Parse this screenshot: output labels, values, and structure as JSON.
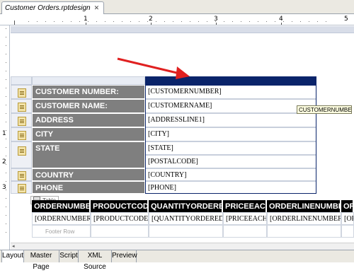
{
  "editor": {
    "tab_title": "Customer Orders.rptdesign",
    "close_glyph": "✕"
  },
  "ruler": {
    "top_numbers": [
      "1",
      "2",
      "3",
      "4",
      "5"
    ],
    "left_numbers": [
      "1",
      "2",
      "3"
    ]
  },
  "grid": {
    "rows": [
      {
        "label": "CUSTOMER NUMBER:",
        "fields": [
          "[CUSTOMERNUMBER]"
        ]
      },
      {
        "label": "CUSTOMER NAME:",
        "fields": [
          "[CUSTOMERNAME]"
        ]
      },
      {
        "label": "ADDRESS",
        "fields": [
          "[ADDRESSLINE1]"
        ]
      },
      {
        "label": "CITY",
        "fields": [
          "[CITY]"
        ]
      },
      {
        "label": "STATE",
        "fields": [
          "[STATE]",
          "[POSTALCODE]"
        ]
      },
      {
        "label": "COUNTRY",
        "fields": [
          "[COUNTRY]"
        ]
      },
      {
        "label": "PHONE",
        "fields": [
          "[PHONE]"
        ]
      }
    ],
    "tooltip": "CUSTOMERNUMBER",
    "accent": "#0a246a",
    "annotation_color": "#e02020"
  },
  "detail_table": {
    "badge": "Table",
    "columns": [
      "ORDERNUMBER",
      "PRODUCTCODE",
      "QUANTITYORDERED",
      "PRICEEACH",
      "ORDERLINENUMBER",
      "ORDE"
    ],
    "detail_row": [
      "[ORDERNUMBER]",
      "[PRODUCTCODE]",
      "[QUANTITYORDERED]",
      "[PRICEEACH]",
      "[ORDERLINENUMBER]",
      "[OR"
    ],
    "footer_label": "Footer Row"
  },
  "bottom_tabs": [
    "Layout",
    "Master Page",
    "Script",
    "XML Source",
    "Preview"
  ]
}
